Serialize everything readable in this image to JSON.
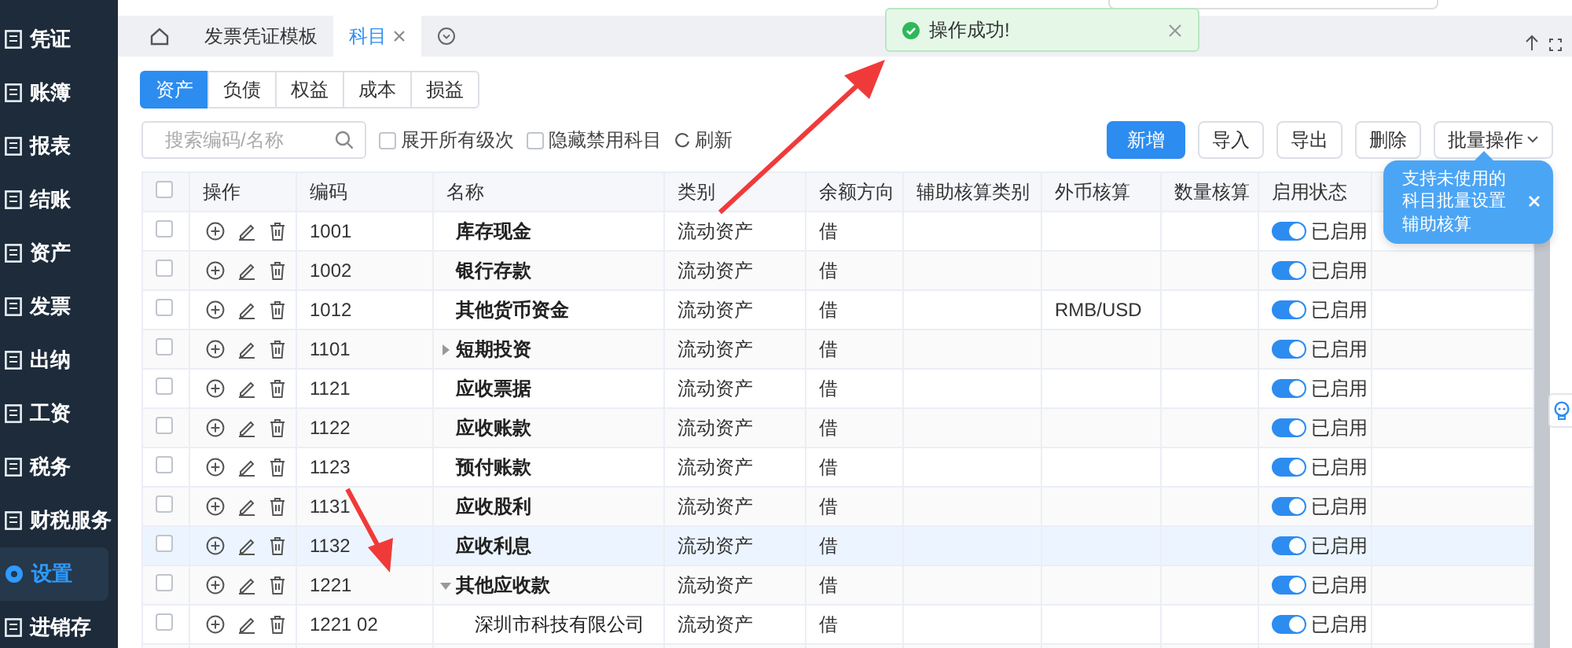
{
  "sidebar": {
    "items": [
      {
        "label": "凭证",
        "selected": false
      },
      {
        "label": "账簿",
        "selected": false
      },
      {
        "label": "报表",
        "selected": false
      },
      {
        "label": "结账",
        "selected": false
      },
      {
        "label": "资产",
        "selected": false
      },
      {
        "label": "发票",
        "selected": false
      },
      {
        "label": "出纳",
        "selected": false
      },
      {
        "label": "工资",
        "selected": false
      },
      {
        "label": "税务",
        "selected": false
      },
      {
        "label": "财税服务",
        "selected": false
      },
      {
        "label": "设置",
        "selected": true
      },
      {
        "label": "进销存",
        "selected": false
      }
    ]
  },
  "tabs": [
    {
      "label": "发票凭证模板",
      "selected": false,
      "closable": false
    },
    {
      "label": "科目",
      "selected": true,
      "closable": true
    }
  ],
  "category_tabs": [
    {
      "label": "资产",
      "selected": true
    },
    {
      "label": "负债",
      "selected": false
    },
    {
      "label": "权益",
      "selected": false
    },
    {
      "label": "成本",
      "selected": false
    },
    {
      "label": "损益",
      "selected": false
    }
  ],
  "toolbar": {
    "search": {
      "placeholder": "搜索编码/名称"
    },
    "checkboxes": [
      {
        "label": "展开所有级次",
        "checked": false
      },
      {
        "label": "隐藏禁用科目",
        "checked": false
      }
    ],
    "refresh": "刷新",
    "buttons": [
      {
        "label": "新增",
        "kind": "primary"
      },
      {
        "label": "导入",
        "kind": "default"
      },
      {
        "label": "导出",
        "kind": "default"
      },
      {
        "label": "删除",
        "kind": "default"
      },
      {
        "label": "批量操作",
        "kind": "dropdown"
      }
    ]
  },
  "table": {
    "columns": [
      "操作",
      "编码",
      "名称",
      "类别",
      "余额方向",
      "辅助核算类别",
      "外币核算",
      "数量核算",
      "启用状态"
    ],
    "select_all_checked": false,
    "rows": [
      {
        "code": "1001",
        "name": "库存现金",
        "category": "流动资产",
        "direction": "借",
        "enabled": true,
        "status": "已启用",
        "checked": false,
        "selected": false
      },
      {
        "code": "1002",
        "name": "银行存款",
        "category": "流动资产",
        "direction": "借",
        "enabled": true,
        "status": "已启用",
        "checked": false,
        "selected": false
      },
      {
        "code": "1012",
        "name": "其他货币资金",
        "category": "流动资产",
        "direction": "借",
        "currency": "RMB/USD",
        "enabled": true,
        "status": "已启用",
        "checked": false,
        "selected": false
      },
      {
        "code": "1101",
        "name": "短期投资",
        "category": "流动资产",
        "direction": "借",
        "enabled": true,
        "status": "已启用",
        "checked": false,
        "selected": false,
        "expanded": false
      },
      {
        "code": "1121",
        "name": "应收票据",
        "category": "流动资产",
        "direction": "借",
        "enabled": true,
        "status": "已启用",
        "checked": false,
        "selected": false
      },
      {
        "code": "1122",
        "name": "应收账款",
        "category": "流动资产",
        "direction": "借",
        "enabled": true,
        "status": "已启用",
        "checked": false,
        "selected": false
      },
      {
        "code": "1123",
        "name": "预付账款",
        "category": "流动资产",
        "direction": "借",
        "enabled": true,
        "status": "已启用",
        "checked": false,
        "selected": false
      },
      {
        "code": "1131",
        "name": "应收股利",
        "category": "流动资产",
        "direction": "借",
        "enabled": true,
        "status": "已启用",
        "checked": false,
        "selected": false
      },
      {
        "code": "1132",
        "name": "应收利息",
        "category": "流动资产",
        "direction": "借",
        "enabled": true,
        "status": "已启用",
        "checked": false,
        "selected": true
      },
      {
        "code": "1221",
        "name": "其他应收款",
        "category": "流动资产",
        "direction": "借",
        "enabled": true,
        "status": "已启用",
        "checked": false,
        "selected": false,
        "expanded": true,
        "children": [
          {
            "code": "1221 02",
            "name": "深圳市科技有限公司",
            "category": "流动资产",
            "direction": "借",
            "enabled": true,
            "status": "已启用",
            "checked": false,
            "selected": false
          }
        ]
      }
    ]
  },
  "toast": {
    "message": "操作成功!"
  },
  "tooltip": {
    "text": "支持未使用的科目批量设置辅助核算"
  }
}
